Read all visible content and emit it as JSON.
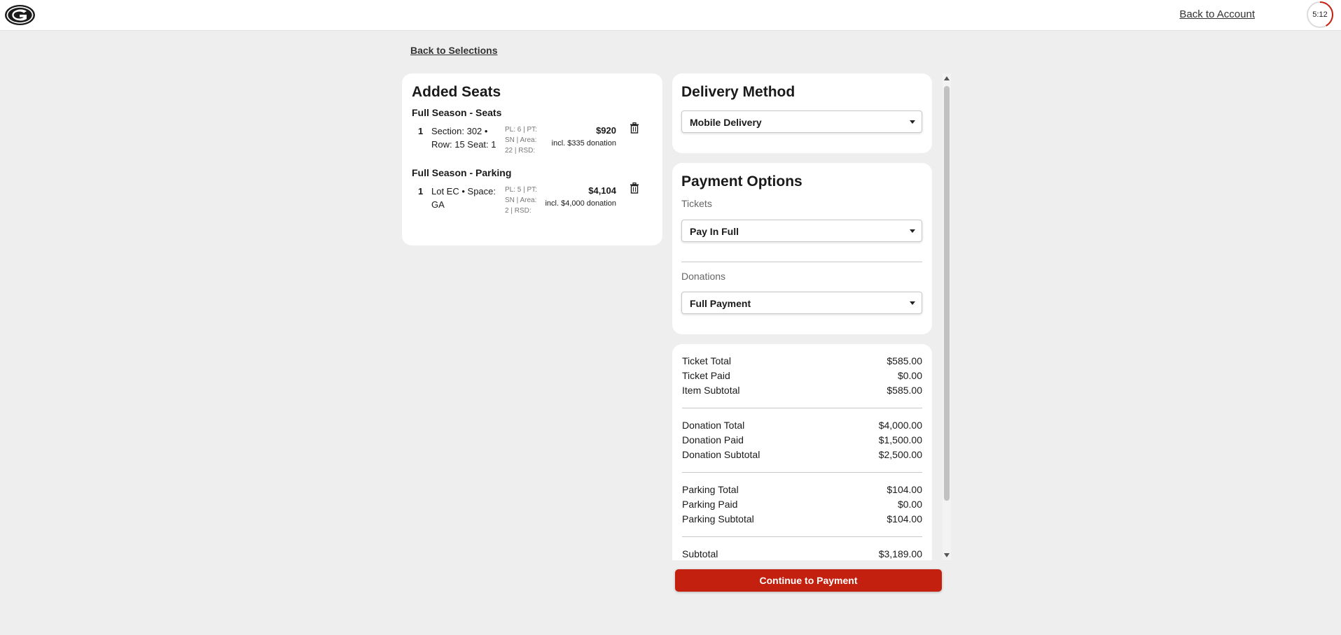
{
  "header": {
    "logo_letter": "G",
    "back_to_account": "Back to Account",
    "timer": "5:12",
    "timer_remaining_fraction": 0.42
  },
  "nav": {
    "back_to_selections": "Back to Selections"
  },
  "added_seats": {
    "title": "Added Seats",
    "groups": [
      {
        "title": "Full Season - Seats",
        "qty": "1",
        "desc_line1": "Section: 302 •",
        "desc_line2": "Row: 15 Seat: 1",
        "meta_line1": "PL: 6 | PT:",
        "meta_line2": "SN | Area:",
        "meta_line3": "22 | RSD:",
        "price": "$920",
        "donation_note": "incl. $335 donation",
        "delete_icon": "trash-icon"
      },
      {
        "title": "Full Season - Parking",
        "qty": "1",
        "desc_line1": "Lot EC • Space:",
        "desc_line2": "GA",
        "meta_line1": "PL: 5 | PT:",
        "meta_line2": "SN | Area:",
        "meta_line3": "2 | RSD:",
        "price": "$4,104",
        "donation_note": "incl. $4,000 donation",
        "delete_icon": "trash-icon"
      }
    ]
  },
  "delivery": {
    "title": "Delivery Method",
    "selected": "Mobile Delivery"
  },
  "payment": {
    "title": "Payment Options",
    "tickets_label": "Tickets",
    "tickets_selected": "Pay In Full",
    "donations_label": "Donations",
    "donations_selected": "Full Payment"
  },
  "summary": {
    "rows": [
      {
        "label": "Ticket Total",
        "value": "$585.00"
      },
      {
        "label": "Ticket Paid",
        "value": "$0.00"
      },
      {
        "label": "Item Subtotal",
        "value": "$585.00"
      },
      {
        "label": "Donation Total",
        "value": "$4,000.00"
      },
      {
        "label": "Donation Paid",
        "value": "$1,500.00"
      },
      {
        "label": "Donation Subtotal",
        "value": "$2,500.00"
      },
      {
        "label": "Parking Total",
        "value": "$104.00"
      },
      {
        "label": "Parking Paid",
        "value": "$0.00"
      },
      {
        "label": "Parking Subtotal",
        "value": "$104.00"
      },
      {
        "label": "Subtotal",
        "value": "$3,189.00"
      }
    ]
  },
  "continue_button": "Continue to Payment",
  "colors": {
    "accent": "#c3200f",
    "background": "#eeeeee",
    "card": "#ffffff"
  }
}
